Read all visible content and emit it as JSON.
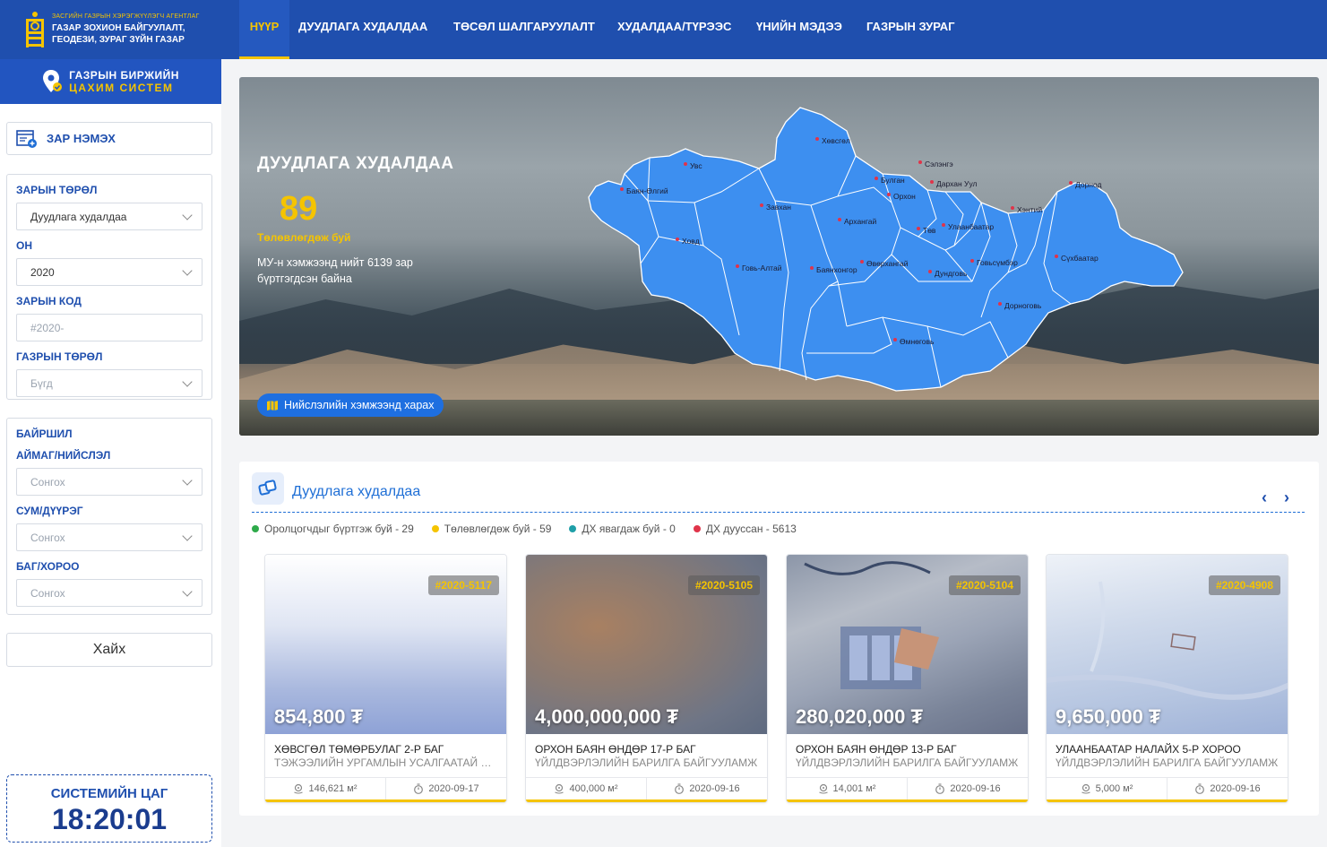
{
  "sidebar": {
    "agency_small": "ЗАСГИЙН ГАЗРЫН ХЭРЭГЖҮҮЛЭГЧ АГЕНТЛАГ",
    "agency_line1": "ГАЗАР ЗОХИОН БАЙГУУЛАЛТ,",
    "agency_line2": "ГЕОДЕЗИ, ЗУРАГ ЗҮЙН ГАЗАР",
    "system_line1": "ГАЗРЫН БИРЖИЙН",
    "system_line2": "ЦАХИМ СИСТЕМ",
    "add_button": "ЗАР НЭМЭХ",
    "filters": {
      "ad_type_label": "ЗАРЫН ТӨРӨЛ",
      "ad_type_value": "Дуудлага худалдаа",
      "year_label": "ОН",
      "year_value": "2020",
      "ad_code_label": "ЗАРЫН КОД",
      "ad_code_placeholder": "#2020-",
      "land_type_label": "ГАЗРЫН ТӨРӨЛ",
      "land_type_value": "Бүгд"
    },
    "location": {
      "title": "БАЙРШИЛ",
      "aimag_label": "АЙМАГ/НИЙСЛЭЛ",
      "aimag_value": "Сонгох",
      "sum_label": "СУМ/ДҮҮРЭГ",
      "sum_value": "Сонгох",
      "bag_label": "БАГ/ХОРОО",
      "bag_value": "Сонгох"
    },
    "search_button": "Хайх",
    "clock_label": "СИСТЕМИЙН ЦАГ",
    "clock_time": "18:20:01"
  },
  "nav": {
    "items": [
      "НҮҮР",
      "ДУУДЛАГА ХУДАЛДАА",
      "ТӨСӨЛ ШАЛГАРУУЛАЛТ",
      "ХУДАЛДАА/ТҮРЭЭС",
      "ҮНИЙН МЭДЭЭ",
      "ГАЗРЫН ЗУРАГ"
    ],
    "active": "НҮҮР"
  },
  "hero": {
    "title": "ДУУДЛАГА ХУДАЛДАА",
    "count": "89",
    "count_label": "Төлөвлөгдөж буй",
    "description": "МУ-н хэмжээнд нийт 6139 зар бүртгэгдсэн байна",
    "button": "Нийслэлийн хэмжээнд харах",
    "map_labels": [
      "Хөвсгөл",
      "Увс",
      "Баян-Өлгий",
      "Завхан",
      "Ховд",
      "Говь-Алтай",
      "Баянхонгор",
      "Архангай",
      "Булган",
      "Орхон",
      "Сэлэнгэ",
      "Дархан Уул",
      "Төв",
      "Улаанбаатар",
      "Хэнтий",
      "Дорнод",
      "Сүхбаатар",
      "Өвөрхангай",
      "Дундговь",
      "Говьсүмбэр",
      "Дорноговь",
      "Өмнөговь"
    ]
  },
  "listing": {
    "title": "Дуудлага худалдаа",
    "legend": [
      {
        "label": "Оролцогчдыг бүртгэж буй - 29",
        "color": "#2eaa4a"
      },
      {
        "label": "Төлөвлөгдөж буй - 59",
        "color": "#f5c400"
      },
      {
        "label": "ДХ явагдаж буй - 0",
        "color": "#1f9fa8"
      },
      {
        "label": "ДХ дууссан - 5613",
        "color": "#e0344a"
      }
    ],
    "cards": [
      {
        "code": "#2020-5117",
        "price": "854,800 ₮",
        "title": "ХӨВСГӨЛ ТӨМӨРБУЛАГ 2-Р БАГ",
        "subtitle": "ТЭЖЭЭЛИЙН УРГАМЛЫН УСАЛГААТАЙ ТАРИАЛАН",
        "area": "146,621 м²",
        "date": "2020-09-17"
      },
      {
        "code": "#2020-5105",
        "price": "4,000,000,000 ₮",
        "title": "ОРХОН БАЯН ӨНДӨР 17-Р БАГ",
        "subtitle": "ҮЙЛДВЭРЛЭЛИЙН БАРИЛГА БАЙГУУЛАМЖ",
        "area": "400,000 м²",
        "date": "2020-09-16"
      },
      {
        "code": "#2020-5104",
        "price": "280,020,000 ₮",
        "title": "ОРХОН БАЯН ӨНДӨР 13-Р БАГ",
        "subtitle": "ҮЙЛДВЭРЛЭЛИЙН БАРИЛГА БАЙГУУЛАМЖ",
        "area": "14,001 м²",
        "date": "2020-09-16"
      },
      {
        "code": "#2020-4908",
        "price": "9,650,000 ₮",
        "title": "УЛААНБААТАР НАЛАЙХ 5-Р ХОРОО",
        "subtitle": "ҮЙЛДВЭРЛЭЛИЙН БАРИЛГА БАЙГУУЛАМЖ",
        "area": "5,000 м²",
        "date": "2020-09-16"
      }
    ]
  },
  "colors": {
    "primary": "#1f4fae",
    "accent": "#f5c400",
    "map_fill": "#3d8ff0"
  },
  "icons": {
    "add": "add-document-icon",
    "pin": "location-pin-icon",
    "map": "map-icon",
    "area": "location-icon",
    "date": "stopwatch-icon",
    "prev": "chevron-left-icon",
    "next": "chevron-right-icon"
  }
}
